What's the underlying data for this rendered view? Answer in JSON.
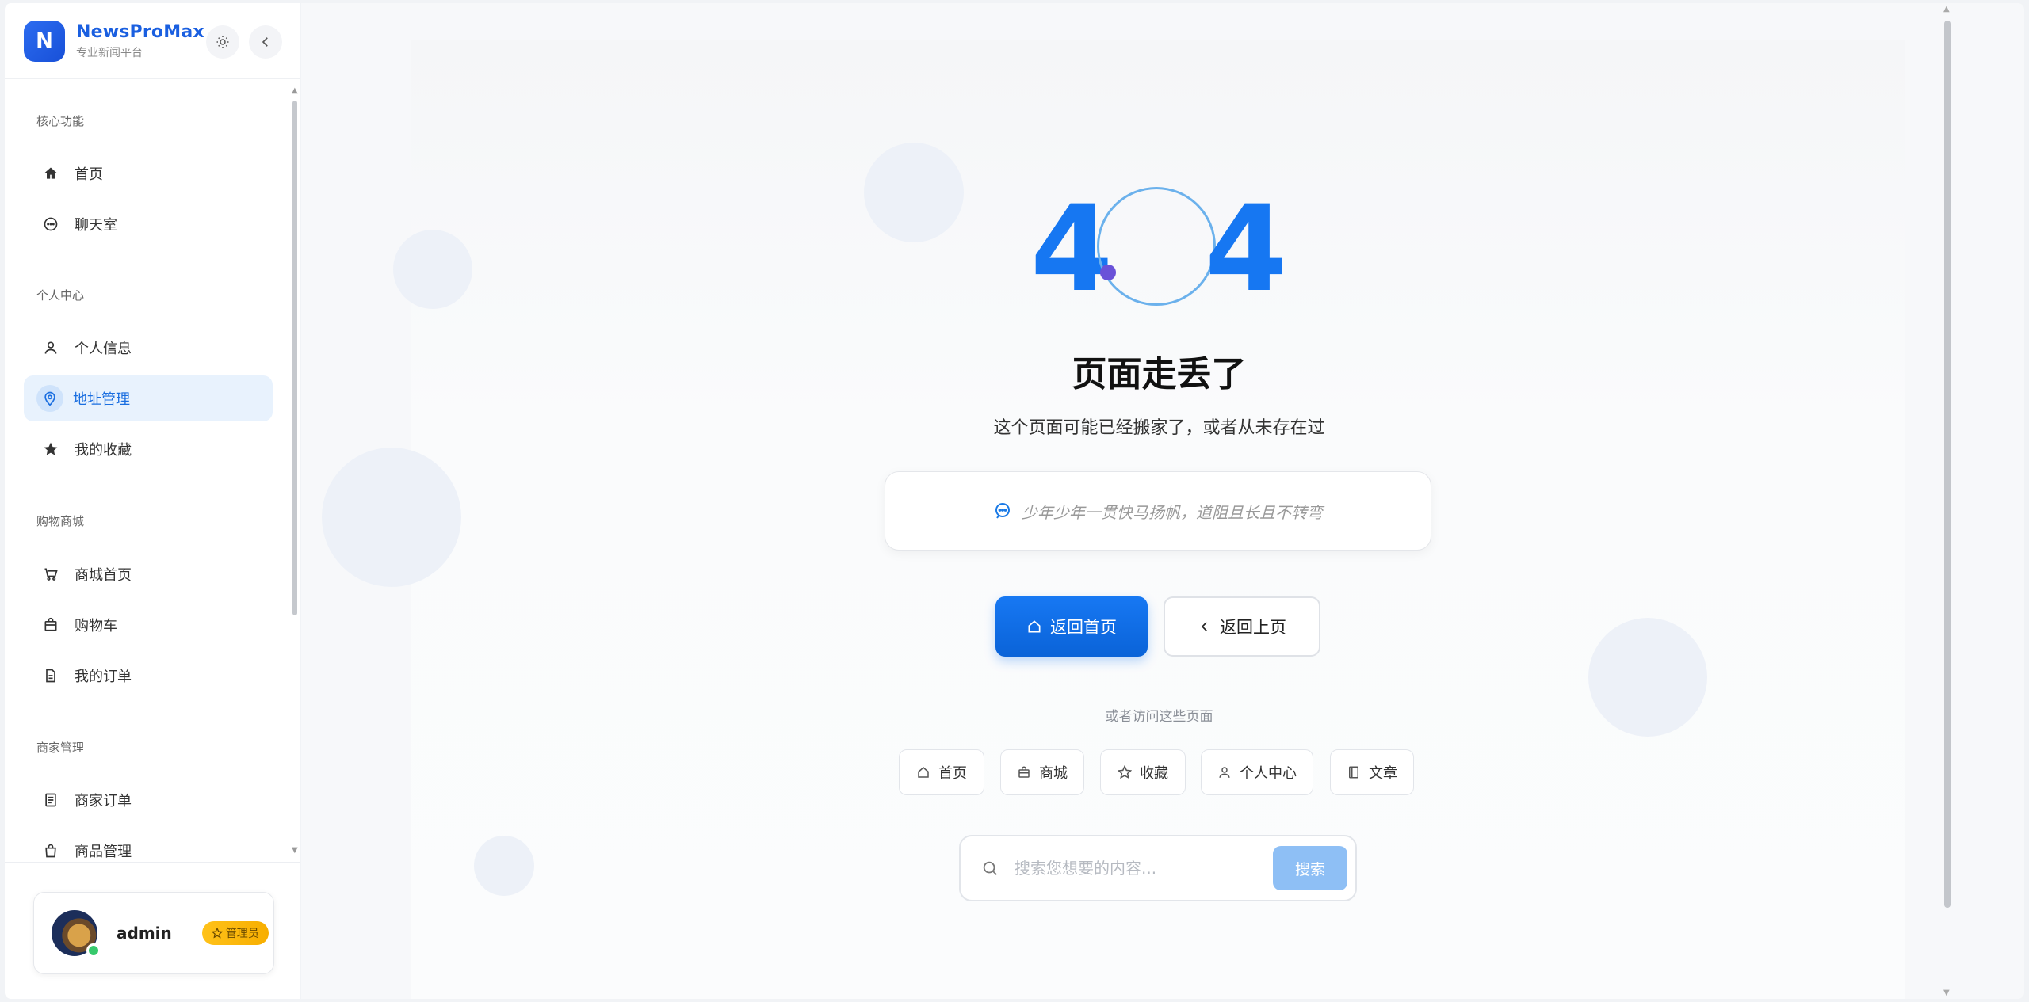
{
  "brand": {
    "logo_letter": "N",
    "name": "NewsProMax",
    "subtitle": "专业新闻平台"
  },
  "sidebar": {
    "groups": [
      {
        "label": "核心功能"
      },
      {
        "label": "个人中心"
      },
      {
        "label": "购物商城"
      },
      {
        "label": "商家管理"
      }
    ],
    "items": [
      {
        "label": "首页",
        "icon": "home-icon"
      },
      {
        "label": "聊天室",
        "icon": "chat-icon"
      },
      {
        "label": "个人信息",
        "icon": "user-icon"
      },
      {
        "label": "地址管理",
        "icon": "location-pin-icon",
        "active": true
      },
      {
        "label": "我的收藏",
        "icon": "star-icon"
      },
      {
        "label": "商城首页",
        "icon": "cart-icon"
      },
      {
        "label": "购物车",
        "icon": "bag-icon"
      },
      {
        "label": "我的订单",
        "icon": "document-icon"
      },
      {
        "label": "商家订单",
        "icon": "list-document-icon"
      },
      {
        "label": "商品管理",
        "icon": "shopping-bag-icon"
      }
    ]
  },
  "user": {
    "name": "admin",
    "role": "管理员",
    "status": "online"
  },
  "error": {
    "code_left": "4",
    "code_right": "4",
    "title": "页面走丢了",
    "description": "这个页面可能已经搬家了，或者从未存在过",
    "quote": "少年少年一贯快马扬帆，道阻且长且不转弯"
  },
  "actions": {
    "home_label": "返回首页",
    "back_label": "返回上页"
  },
  "quick_links": {
    "intro": "或者访问这些页面",
    "items": [
      {
        "label": "首页",
        "icon": "home-icon"
      },
      {
        "label": "商城",
        "icon": "bag-icon"
      },
      {
        "label": "收藏",
        "icon": "star-outline-icon"
      },
      {
        "label": "个人中心",
        "icon": "user-icon"
      },
      {
        "label": "文章",
        "icon": "book-icon"
      }
    ]
  },
  "search": {
    "placeholder": "搜索您想要的内容...",
    "button_label": "搜索"
  },
  "colors": {
    "accent": "#1677f2",
    "active_bg": "#e8f2fd",
    "badge": "#ffc21a",
    "online": "#37c96c"
  }
}
